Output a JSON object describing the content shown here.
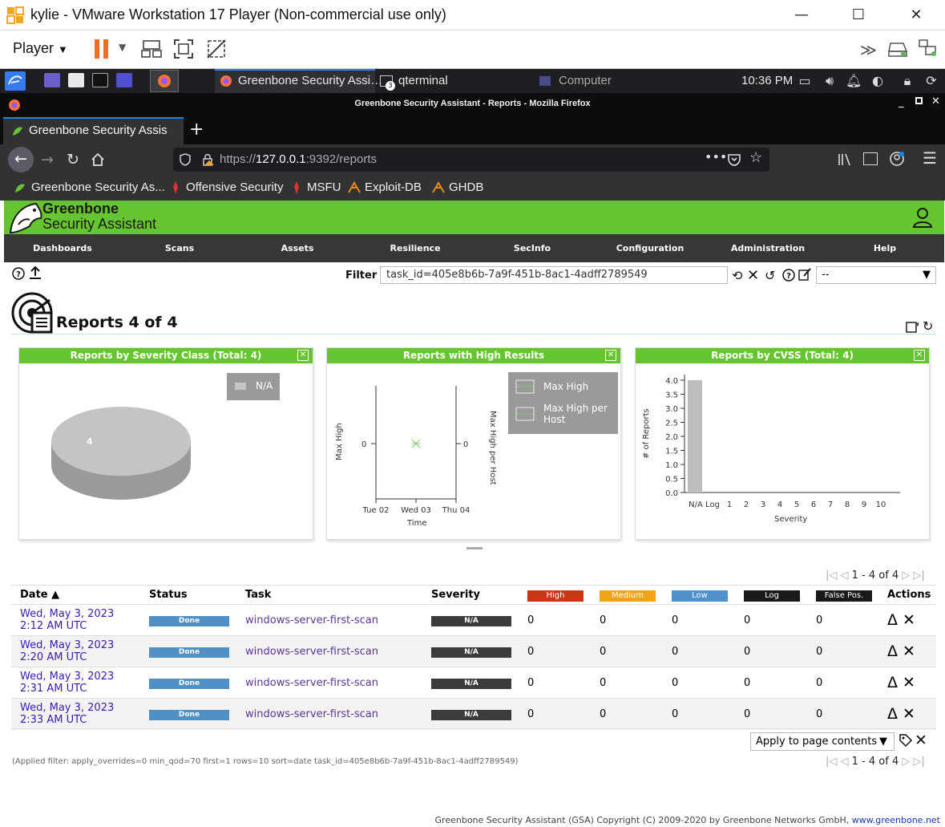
{
  "vm": {
    "title": "kylie - VMware Workstation 17 Player (Non-commercial use only)",
    "player_label": "Player"
  },
  "kali": {
    "tasks": [
      "Greenbone Security Assi…",
      "qterminal",
      "Computer"
    ],
    "qterminal_count": "3",
    "clock": "10:36 PM"
  },
  "firefox": {
    "window_title": "Greenbone Security Assistant - Reports - Mozilla Firefox",
    "tab_title": "Greenbone Security Assis",
    "url_prefix": "https://",
    "url_host": "127.0.0.1",
    "url_rest": ":9392/reports",
    "bookmarks": [
      "Greenbone Security As...",
      "Offensive Security",
      "MSFU",
      "Exploit-DB",
      "GHDB"
    ]
  },
  "gsa": {
    "brand_line1": "Greenbone",
    "brand_line2": "Security Assistant",
    "nav": [
      "Dashboards",
      "Scans",
      "Assets",
      "Resilience",
      "SecInfo",
      "Configuration",
      "Administration",
      "Help"
    ],
    "filter_label": "Filter",
    "filter_value": "task_id=405e8b6b-7a9f-451b-8ac1-4adff2789549",
    "filter_select": "--",
    "page_title": "Reports 4 of 4",
    "charts": {
      "severity_class_title": "Reports by Severity Class (Total: 4)",
      "high_results_title": "Reports with High Results",
      "cvss_title": "Reports by CVSS (Total: 4)"
    },
    "pager_text": "1 - 4 of 4",
    "columns": {
      "date": "Date ▲",
      "status": "Status",
      "task": "Task",
      "severity": "Severity",
      "high": "High",
      "medium": "Medium",
      "low": "Low",
      "log": "Log",
      "false_pos": "False Pos.",
      "actions": "Actions"
    },
    "rows": [
      {
        "date": "Wed, May 3, 2023 2:12 AM UTC",
        "status": "Done",
        "task": "windows-server-first-scan",
        "severity": "N/A",
        "high": "0",
        "medium": "0",
        "low": "0",
        "log": "0",
        "false_pos": "0"
      },
      {
        "date": "Wed, May 3, 2023 2:20 AM UTC",
        "status": "Done",
        "task": "windows-server-first-scan",
        "severity": "N/A",
        "high": "0",
        "medium": "0",
        "low": "0",
        "log": "0",
        "false_pos": "0"
      },
      {
        "date": "Wed, May 3, 2023 2:31 AM UTC",
        "status": "Done",
        "task": "windows-server-first-scan",
        "severity": "N/A",
        "high": "0",
        "medium": "0",
        "low": "0",
        "log": "0",
        "false_pos": "0"
      },
      {
        "date": "Wed, May 3, 2023 2:33 AM UTC",
        "status": "Done",
        "task": "windows-server-first-scan",
        "severity": "N/A",
        "high": "0",
        "medium": "0",
        "low": "0",
        "log": "0",
        "false_pos": "0"
      }
    ],
    "bulk_action": "Apply to page contents",
    "applied_filter": "(Applied filter: apply_overrides=0 min_qod=70 first=1 rows=10 sort=date task_id=405e8b6b-7a9f-451b-8ac1-4adff2789549)",
    "footer_text": "Greenbone Security Assistant (GSA) Copyright (C) 2009-2020 by Greenbone Networks GmbH,",
    "footer_link": "www.greenbone.net",
    "colors": {
      "green": "#66c430",
      "high": "#c83814",
      "medium": "#f0a519",
      "low": "#4f91cd",
      "log": "#191919",
      "false_pos": "#191919"
    }
  },
  "chart_data": [
    {
      "type": "pie",
      "title": "Reports by Severity Class (Total: 4)",
      "categories": [
        "N/A"
      ],
      "values": [
        4
      ],
      "slice_label": "4",
      "legend": [
        "N/A"
      ],
      "legend_position": "top-right"
    },
    {
      "type": "line",
      "title": "Reports with High Results",
      "x": [
        "Tue 02",
        "Wed 03",
        "Thu 04"
      ],
      "xlabel": "Time",
      "ylabel": "Max High",
      "y2label": "Max High per Host",
      "y_ticks": [
        "0"
      ],
      "y2_ticks": [
        "0"
      ],
      "series": [
        {
          "name": "Max High",
          "points": [
            {
              "x": "Wed 03",
              "y": 0
            }
          ]
        },
        {
          "name": "Max High per Host",
          "points": [
            {
              "x": "Wed 03",
              "y": 0
            }
          ]
        }
      ],
      "legend_position": "top-right"
    },
    {
      "type": "bar",
      "title": "Reports by CVSS (Total: 4)",
      "categories": [
        "N/A",
        "Log",
        "1",
        "2",
        "3",
        "4",
        "5",
        "6",
        "7",
        "8",
        "9",
        "10"
      ],
      "values": [
        4,
        0,
        0,
        0,
        0,
        0,
        0,
        0,
        0,
        0,
        0,
        0
      ],
      "xlabel": "Severity",
      "ylabel": "# of Reports",
      "y_ticks": [
        "0.0",
        "0.5",
        "1.0",
        "1.5",
        "2.0",
        "2.5",
        "3.0",
        "3.5",
        "4.0"
      ],
      "ylim": [
        0,
        4
      ]
    }
  ]
}
